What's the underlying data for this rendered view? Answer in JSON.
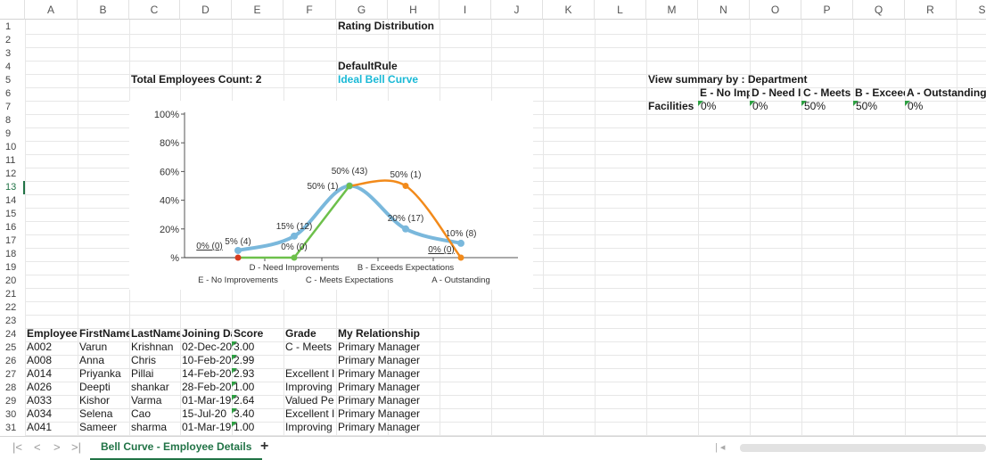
{
  "columns": [
    "A",
    "B",
    "C",
    "D",
    "E",
    "F",
    "G",
    "H",
    "I",
    "J",
    "K",
    "L",
    "M",
    "N",
    "O",
    "P",
    "Q",
    "R",
    "S"
  ],
  "rows": [
    "1",
    "2",
    "3",
    "4",
    "5",
    "6",
    "7",
    "8",
    "9",
    "10",
    "11",
    "12",
    "13",
    "14",
    "15",
    "16",
    "17",
    "18",
    "19",
    "20",
    "21",
    "22",
    "23",
    "24",
    "25",
    "26",
    "27",
    "28",
    "29",
    "30",
    "31"
  ],
  "header": {
    "title": "Rating Distribution",
    "rule": "DefaultRule",
    "total_count": "Total Employees Count: 2",
    "ideal_curve": "Ideal Bell Curve"
  },
  "summary": {
    "view_by": "View summary by : Department",
    "headers": [
      "E - No Impr",
      "D - Need In",
      "C - Meets E",
      "B - Exceeds",
      "A - Outstanding"
    ],
    "row_label": "Facilities",
    "values": [
      "0%",
      "0%",
      "50%",
      "50%",
      "0%"
    ]
  },
  "chart_data": {
    "type": "line",
    "categories": [
      "E - No Improvements",
      "D - Need Improvements",
      "C - Meets Expectations",
      "B - Exceeds Expectations",
      "A - Outstanding"
    ],
    "x_labels_upper": [
      "D - Need Improvements",
      "B - Exceeds Expectations"
    ],
    "x_labels_lower": [
      "E - No Improvements",
      "C - Meets Expectations",
      "A - Outstanding"
    ],
    "y_ticks": [
      "100%",
      "80%",
      "60%",
      "40%",
      "20%",
      "%"
    ],
    "ylim": [
      0,
      100
    ],
    "series": [
      {
        "values": [
          5,
          15,
          50,
          20,
          10
        ],
        "labels": [
          "5% (4)",
          "15% (12)",
          "50% (43)",
          "20% (17)",
          "10% (8)"
        ],
        "color": "#7ab8dc"
      },
      {
        "values": [
          0,
          0,
          50,
          50,
          0
        ],
        "labels": [
          "0% (0)",
          "0% (0)",
          "50% (1)",
          "50% (1)",
          "0% (0)"
        ],
        "color_left": "#6dc04b",
        "color_right": "#f28a1a"
      }
    ]
  },
  "table": {
    "headers": [
      "EmployeeN",
      "FirstName",
      "LastName",
      "Joining Dat",
      "Score",
      "Grade",
      "My Relationship"
    ],
    "rows": [
      [
        "A002",
        "Varun",
        "Krishnan",
        "02-Dec-20",
        "3.00",
        "C - Meets",
        "Primary Manager"
      ],
      [
        "A008",
        "Anna",
        "Chris",
        "10-Feb-20",
        "2.99",
        "",
        "Primary Manager"
      ],
      [
        "A014",
        "Priyanka",
        "Pillai",
        "14-Feb-20",
        "2.93",
        "Excellent I",
        "Primary Manager"
      ],
      [
        "A026",
        "Deepti",
        "shankar",
        "28-Feb-20",
        "1.00",
        "Improving",
        "Primary Manager"
      ],
      [
        "A033",
        "Kishor",
        "Varma",
        "01-Mar-19",
        "2.64",
        "Valued Pe",
        "Primary Manager"
      ],
      [
        "A034",
        "Selena",
        "Cao",
        "15-Jul-20",
        "3.40",
        "Excellent I",
        "Primary Manager"
      ],
      [
        "A041",
        "Sameer",
        "sharma",
        "01-Mar-19",
        "1.00",
        "Improving",
        "Primary Manager"
      ]
    ]
  },
  "tabs": {
    "active": "Bell Curve - Employee Details",
    "add": "+"
  },
  "nav": {
    "first": "|<",
    "prev": "<",
    "next": ">",
    "last": ">|"
  },
  "accent": "#217346"
}
